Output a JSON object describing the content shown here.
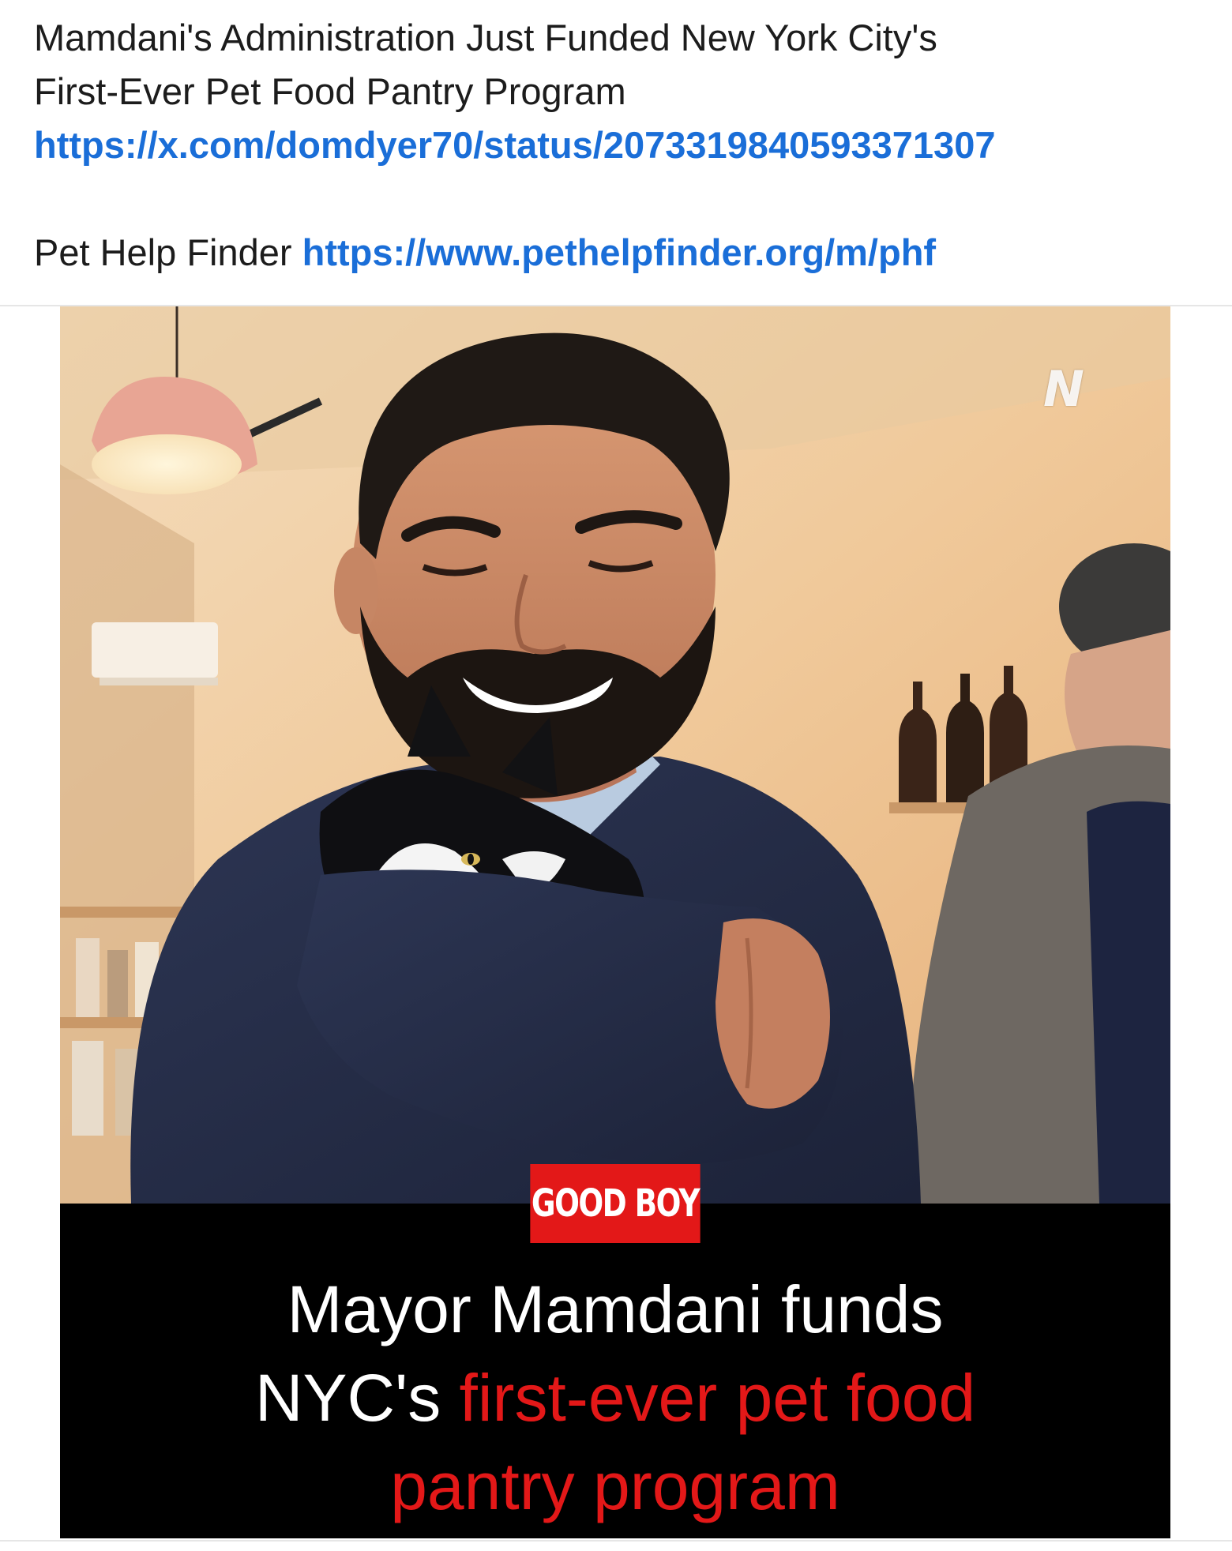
{
  "post": {
    "title_line1": "Mamdani's Administration Just Funded New York City's",
    "title_line2": "First-Ever Pet Food Pantry Program",
    "link1": "https://x.com/domdyer70/status/2073319840593371307",
    "finder_label": "Pet Help Finder",
    "link2": "https://www.pethelpfinder.org/m/phf"
  },
  "image": {
    "watermark": "N",
    "tag": "GOOD BOY",
    "headline_white": "Mayor Mamdani funds NYC's",
    "headline_red": "first-ever pet food pantry program",
    "headline_l1": "Mayor Mamdani funds",
    "headline_l2_white": "NYC's ",
    "headline_l2_red": "first-ever pet food",
    "headline_l3_red": "pantry program"
  },
  "colors": {
    "link": "#1a6ed8",
    "accent_red": "#e31818",
    "band": "#000000"
  }
}
